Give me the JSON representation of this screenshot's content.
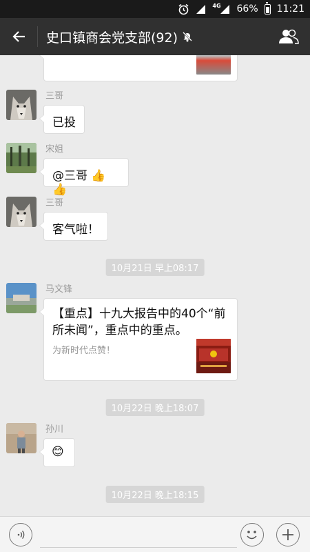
{
  "status_bar": {
    "network": "4G",
    "battery": "66%",
    "battery_level": 0.66,
    "time": "11:21",
    "icons": [
      "alarm-icon",
      "signal-icon",
      "battery-icon"
    ]
  },
  "header": {
    "title": "史口镇商会党支部(92)",
    "back_icon": "back-arrow-icon",
    "mute_icon": "mute-bell-icon",
    "members_icon": "group-members-icon"
  },
  "messages": [
    {
      "sender": "三哥",
      "text": "已投",
      "avatar": "wolf"
    },
    {
      "sender": "宋姐",
      "text": "@三哥 👍👍",
      "avatar": "forest"
    },
    {
      "sender": "三哥",
      "text": "客气啦！",
      "avatar": "wolf"
    }
  ],
  "timestamps": [
    "10月21日 早上08:17",
    "10月22日 晚上18:07",
    "10月22日 晚上18:15"
  ],
  "link_message": {
    "sender": "马文锋",
    "title": "【重点】十九大报告中的40个“前所未闻”，重点中的重点。",
    "description": "为新时代点赞！",
    "thumbnail_icon": "congress-hall-thumbnail"
  },
  "emoji_message": {
    "sender": "孙川",
    "emoji": "😊"
  },
  "input_bar": {
    "placeholder": "",
    "voice_icon": "voice-icon",
    "emoji_icon": "emoji-icon",
    "plus_icon": "plus-icon"
  },
  "colors": {
    "title_bar": "#303030",
    "status_bar": "#1a1a1a",
    "chat_background": "#ebebeb",
    "bubble": "#ffffff",
    "timestamp_bg": "#d6d6d6"
  }
}
